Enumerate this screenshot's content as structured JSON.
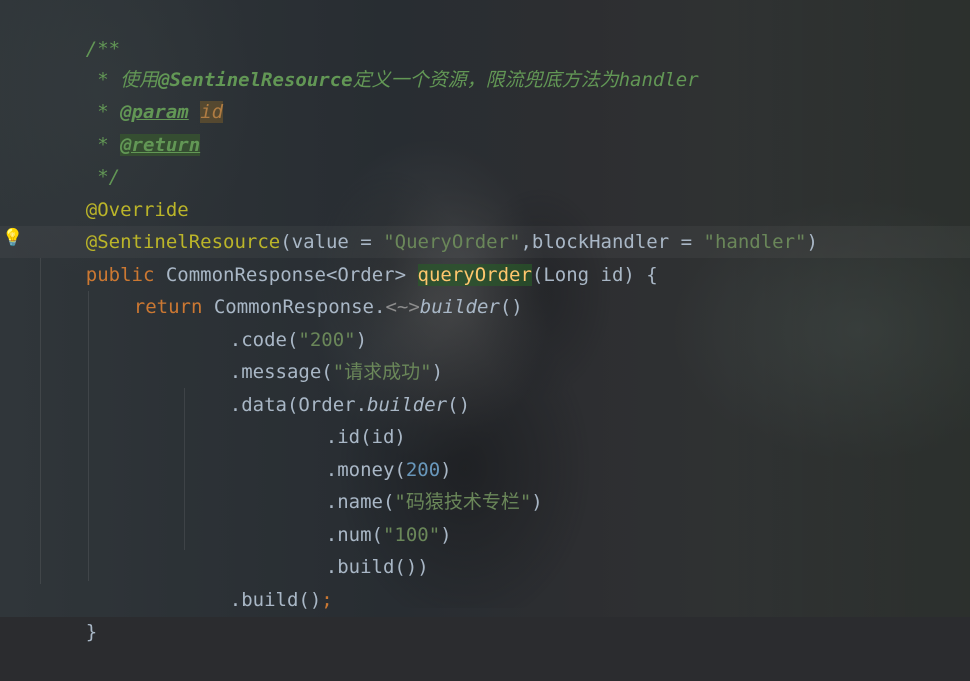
{
  "editor": {
    "lines": {
      "l1": "/**",
      "l2_prefix": " * ",
      "l2_text_1": "使用",
      "l2_text_2": "@SentinelResource",
      "l2_text_3": "定义一个资源，限流兜底方法为",
      "l2_text_4": "handler",
      "l3_prefix": " * ",
      "l3_tag": "@param",
      "l3_param": "id",
      "l4_prefix": " * ",
      "l4_tag": "@return",
      "l5": " */",
      "l6": "@Override",
      "l7_1": "@SentinelResource",
      "l7_2": "(value = ",
      "l7_3": "\"QueryOrder\"",
      "l7_4": ",blockHandler = ",
      "l7_5": "\"handler\"",
      "l7_6": ")",
      "l8_1": "public ",
      "l8_2": "CommonResponse<Order> ",
      "l8_3": "queryOrder",
      "l8_4": "(Long id) {",
      "l9_1": "return ",
      "l9_2": "CommonResponse.",
      "l9_3": "<~>",
      "l9_4": "builder",
      "l9_5": "()",
      "l10_1": ".code(",
      "l10_2": "\"200\"",
      "l10_3": ")",
      "l11_1": ".message(",
      "l11_2": "\"请求成功\"",
      "l11_3": ")",
      "l12_1": ".data(Order.",
      "l12_2": "builder",
      "l12_3": "()",
      "l13": ".id(id)",
      "l14_1": ".money(",
      "l14_2": "200",
      "l14_3": ")",
      "l15_1": ".name(",
      "l15_2": "\"码猿技术专栏\"",
      "l15_3": ")",
      "l16_1": ".num(",
      "l16_2": "\"100\"",
      "l16_3": ")",
      "l17": ".build())",
      "l18_1": ".build()",
      "l18_2": ";",
      "l19": "}"
    },
    "icons": {
      "gutter_hint": "lightbulb-icon"
    },
    "colors": {
      "keyword": "#cc7832",
      "string": "#6a8759",
      "comment": "#629755",
      "annotation": "#bbb529",
      "method": "#ffc66d",
      "number": "#6897bb",
      "text": "#a9b7c6"
    }
  }
}
